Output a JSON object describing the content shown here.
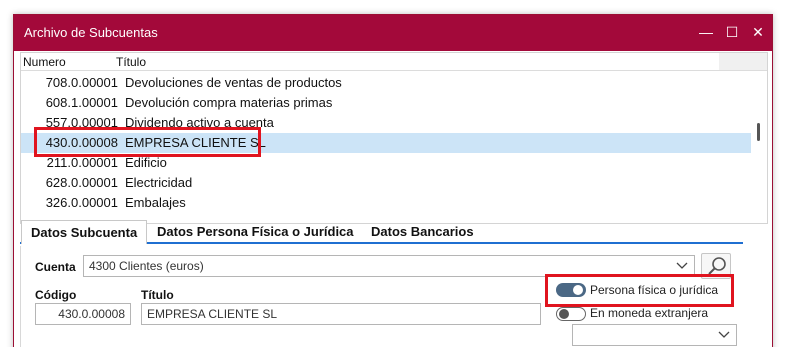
{
  "window": {
    "title": "Archivo de Subcuentas",
    "controls": {
      "minimize": "—",
      "maximize": "☐",
      "close": "✕"
    }
  },
  "grid": {
    "columns": {
      "numero": "Numero",
      "titulo": "Título"
    },
    "rows": [
      {
        "numero": "708.0.00001",
        "titulo": "Devoluciones de ventas de productos"
      },
      {
        "numero": "608.1.00001",
        "titulo": "Devolución compra materias primas"
      },
      {
        "numero": "557.0.00001",
        "titulo": "Dividendo activo a cuenta"
      },
      {
        "numero": "430.0.00008",
        "titulo": "EMPRESA CLIENTE SL",
        "selected": true
      },
      {
        "numero": "211.0.00001",
        "titulo": "Edificio"
      },
      {
        "numero": "628.0.00001",
        "titulo": "Electricidad"
      },
      {
        "numero": "326.0.00001",
        "titulo": "Embalajes"
      }
    ]
  },
  "tabs": [
    {
      "label": "Datos Subcuenta",
      "active": true
    },
    {
      "label": "Datos Persona Física o Jurídica",
      "active": false
    },
    {
      "label": "Datos Bancarios",
      "active": false
    }
  ],
  "form": {
    "cuenta_label": "Cuenta",
    "cuenta_value": "4300  Clientes (euros)",
    "codigo_label": "Código",
    "codigo_value": "430.0.00008",
    "titulo_label": "Título",
    "titulo_value": "EMPRESA CLIENTE SL",
    "toggle_persona_label": "Persona física o jurídica",
    "toggle_persona_on": true,
    "toggle_moneda_label": "En moneda extranjera",
    "toggle_moneda_on": false,
    "moneda_value": ""
  },
  "colors": {
    "titlebar": "#a3093a",
    "selected_row": "#cce4f7",
    "highlight_box": "#e0141f",
    "tab_underline": "#1f6fd1",
    "toggle_on": "#4b6885"
  },
  "icons": {
    "search": "search-icon",
    "dropdown": "chevron-down-icon"
  }
}
